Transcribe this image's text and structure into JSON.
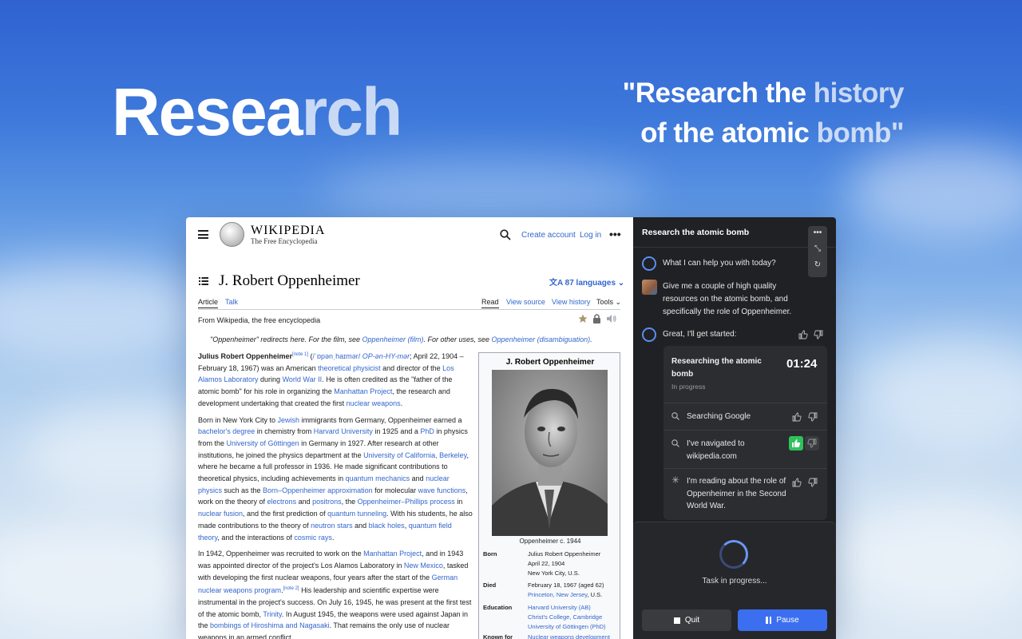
{
  "hero": {
    "title_part1": "Resea",
    "title_part2": "rch",
    "quote_line1a": "\"Research the ",
    "quote_line1b": "history",
    "quote_line2a": "of the atomic ",
    "quote_line2b": "bomb\""
  },
  "wikipedia": {
    "logo_title": "WIKIPEDIA",
    "logo_subtitle": "The Free Encyclopedia",
    "create_account": "Create account",
    "log_in": "Log in",
    "more": "•••",
    "page_title": "J. Robert Oppenheimer",
    "languages": "87 languages",
    "tabs": {
      "article": "Article",
      "talk": "Talk",
      "read": "Read",
      "view_source": "View source",
      "view_history": "View history",
      "tools": "Tools"
    },
    "from": "From Wikipedia, the free encyclopedia",
    "hatnote": {
      "pre": "\"Oppenheimer\" redirects here. For the film, see ",
      "film": "Oppenheimer (film)",
      "mid": ". For other uses, see ",
      "disamb": "Oppenheimer (disambiguation)",
      "post": "."
    },
    "para1": {
      "name": "Julius Robert Oppenheimer",
      "note": "[note 1]",
      "t1": " (",
      "ipa": "/ˈɒpənˌhaɪmər/",
      "t2": " ",
      "resp": "OP-ən-HY-mər",
      "t3": "; April 22, 1904 – February 18, 1967) was an American ",
      "l1": "theoretical physicist",
      "t4": " and director of the ",
      "l2": "Los Alamos Laboratory",
      "t5": " during ",
      "l3": "World War II",
      "t6": ". He is often credited as the \"father of the atomic bomb\" for his role in organizing the ",
      "l4": "Manhattan Project",
      "t7": ", the research and development undertaking that created the first ",
      "l5": "nuclear weapons",
      "t8": "."
    },
    "para2": {
      "t1": "Born in New York City to ",
      "l1": "Jewish",
      "t2": " immigrants from Germany, Oppenheimer earned a ",
      "l2": "bachelor's degree",
      "t3": " in chemistry from ",
      "l3": "Harvard University",
      "t4": " in 1925 and a ",
      "l4": "PhD",
      "t5": " in physics from the ",
      "l5": "University of Göttingen",
      "t6": " in Germany in 1927. After research at other institutions, he joined the physics department at the ",
      "l6": "University of California, Berkeley",
      "t7": ", where he became a full professor in 1936. He made significant contributions to theoretical physics, including achievements in ",
      "l7": "quantum mechanics",
      "t8": " and ",
      "l8": "nuclear physics",
      "t9": " such as the ",
      "l9": "Born–Oppenheimer approximation",
      "t10": " for molecular ",
      "l10": "wave functions",
      "t11": ", work on the theory of ",
      "l11": "electrons",
      "t12": " and ",
      "l12": "positrons",
      "t13": ", the ",
      "l13": "Oppenheimer–Phillips process",
      "t14": " in ",
      "l14": "nuclear fusion",
      "t15": ", and the first prediction of ",
      "l15": "quantum tunneling",
      "t16": ". With his students, he also made contributions to the theory of ",
      "l16": "neutron stars",
      "t17": " and ",
      "l17": "black holes",
      "t18": ", ",
      "l18": "quantum field theory",
      "t19": ", and the interactions of ",
      "l19": "cosmic rays",
      "t20": "."
    },
    "para3": {
      "t1": "In 1942, Oppenheimer was recruited to work on the ",
      "l1": "Manhattan Project",
      "t2": ", and in 1943 was appointed director of the project's Los Alamos Laboratory in ",
      "l2": "New Mexico",
      "t3": ", tasked with developing the first nuclear weapons, four years after the start of the ",
      "l3": "German nuclear weapons program",
      "t4": ".",
      "note": "[note 2]",
      "t5": " His leadership and scientific expertise were instrumental in the project's success. On July 16, 1945, he was present at the first test of the atomic bomb, ",
      "l4": "Trinity",
      "t6": ". In August 1945, the weapons were used against Japan in the ",
      "l5": "bombings of Hiroshima and Nagasaki",
      "t7": ". That remains the only use of nuclear weapons in an armed conflict."
    },
    "infobox": {
      "title": "J. Robert Oppenheimer",
      "caption": "Oppenheimer c. 1944",
      "born_label": "Born",
      "born_1": "Julius Robert Oppenheimer",
      "born_2": "April 22, 1904",
      "born_3": "New York City, U.S.",
      "died_label": "Died",
      "died_1": "February 18, 1967 (aged 62)",
      "died_2_link": "Princeton, New Jersey",
      "died_2_rest": ", U.S.",
      "edu_label": "Education",
      "edu_1": "Harvard University (AB)",
      "edu_2": "Christ's College, Cambridge",
      "edu_3": "University of Göttingen (PhD)",
      "known_label": "Known for",
      "known_1": "Nuclear weapons development"
    }
  },
  "panel": {
    "title": "Research the atomic bomb",
    "assistant_greeting": "What I can help you with today?",
    "user_message": "Give me a couple of high quality resources on the atomic bomb, and specifically the role of Oppenheimer.",
    "assistant_reply": "Great, I'll get started:",
    "task": {
      "title": "Researching the atomic bomb",
      "timer": "01:24",
      "status": "In progress"
    },
    "steps": [
      {
        "text": "Searching Google"
      },
      {
        "text": "I've navigated to wikipedia.com"
      },
      {
        "text": "I'm reading about the role of Oppenheimer in the Second World War."
      }
    ],
    "progress_text": "Task in progress...",
    "quit_label": "Quit",
    "pause_label": "Pause"
  },
  "colors": {
    "accent": "#3c6ef0",
    "link": "#3366cc",
    "thumbs_up_active": "#2fc25b"
  }
}
